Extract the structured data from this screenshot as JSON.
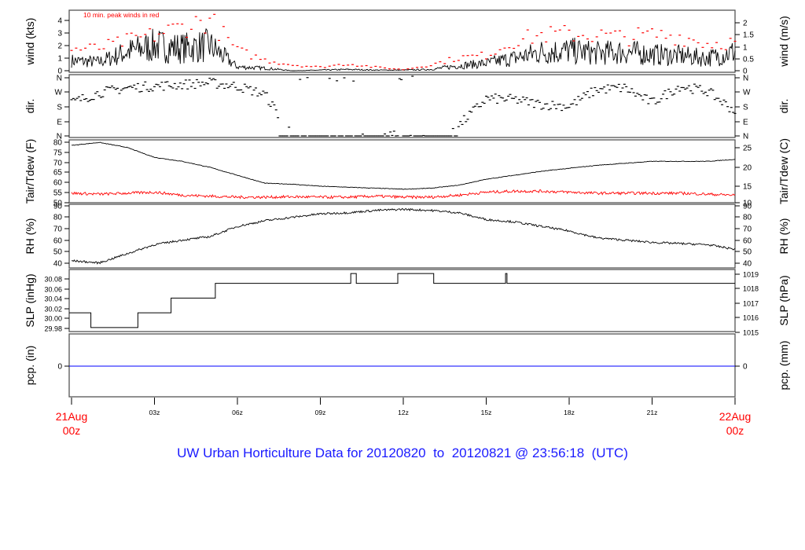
{
  "title": "UW Urban Horticulture Data for 20120820  to  20120821 @ 23:56:18  (UTC)",
  "chart_data": {
    "type": "line",
    "x_unit": "hours since 21Aug 00z",
    "x_ticks": [
      {
        "h": 0,
        "label": "21Aug",
        "sub": "00z"
      },
      {
        "h": 3,
        "label": "03z"
      },
      {
        "h": 6,
        "label": "06z"
      },
      {
        "h": 9,
        "label": "09z"
      },
      {
        "h": 12,
        "label": "12z"
      },
      {
        "h": 15,
        "label": "15z"
      },
      {
        "h": 18,
        "label": "18z"
      },
      {
        "h": 21,
        "label": "21z"
      },
      {
        "h": 24,
        "label": "22Aug",
        "sub": "00z"
      }
    ],
    "hours": [
      0,
      1,
      2,
      3,
      4,
      5,
      6,
      7,
      8,
      9,
      10,
      11,
      12,
      13,
      14,
      15,
      16,
      17,
      18,
      19,
      20,
      21,
      22,
      23,
      24
    ],
    "panels": [
      {
        "id": "wind",
        "ylabel": "wind (kts)",
        "ylabel_right": "wind (m/s)",
        "ylim": [
          0,
          4.7
        ],
        "yticks": [
          "0",
          "1",
          "2",
          "3",
          "4"
        ],
        "yticks_right": [
          "0",
          "0.5",
          "1",
          "1.5",
          "2"
        ],
        "annotation": "10 min. peak winds in red",
        "series": [
          {
            "name": "wind",
            "color": "#000000",
            "values": [
              0.8,
              0.7,
              1.5,
              2.0,
              1.8,
              2.0,
              0.3,
              0.2,
              0,
              0.05,
              0.1,
              0.05,
              0.05,
              0.1,
              0.4,
              0.6,
              1.0,
              1.5,
              1.6,
              1.4,
              1.5,
              1.3,
              1.2,
              1.0,
              1.5
            ]
          },
          {
            "name": "peak",
            "color": "#ff0000",
            "values": [
              1.8,
              1.9,
              2.5,
              3.0,
              3.7,
              4.3,
              1.7,
              0.9,
              0.5,
              0.3,
              0.6,
              0.3,
              0.1,
              0.5,
              1.1,
              1.3,
              2.5,
              3.0,
              3.1,
              3.0,
              2.8,
              3.0,
              2.9,
              2.3,
              2.4
            ]
          }
        ]
      },
      {
        "id": "dir",
        "ylabel": "dir.",
        "ylabel_right": "dir.",
        "ylim": [
          0,
          360
        ],
        "yticks": [
          "N",
          "E",
          "S",
          "W",
          "N"
        ],
        "yticks_right": [
          "N",
          "E",
          "S",
          "W",
          "N"
        ],
        "series": [
          {
            "name": "direction (deg)",
            "color": "#000000",
            "values": [
              200,
              260,
              290,
              300,
              310,
              320,
              300,
              250,
              0,
              0,
              0,
              0,
              0,
              0,
              60,
              225,
              220,
              190,
              180,
              280,
              290,
              200,
              300,
              270,
              150
            ]
          }
        ]
      },
      {
        "id": "temp",
        "ylabel": "Tair/Tdew (F)",
        "ylabel_right": "Tair/Tdew (C)",
        "ylim": [
          50,
          80
        ],
        "yticks": [
          "50",
          "55",
          "60",
          "65",
          "70",
          "75",
          "80"
        ],
        "yticks_right": [
          "10",
          "15",
          "20",
          "25"
        ],
        "series": [
          {
            "name": "Tair",
            "color": "#000000",
            "values": [
              78,
              79.5,
              77,
              72,
              70,
              67,
              63,
              59,
              58.5,
              57.5,
              57,
              56.5,
              56,
              56.5,
              58,
              61,
              63,
              65,
              66.5,
              68,
              69,
              70,
              70,
              70,
              71
            ]
          },
          {
            "name": "Tdew",
            "color": "#ff0000",
            "values": [
              54,
              53.5,
              54,
              54.5,
              53,
              52.5,
              52,
              52,
              52.2,
              52,
              52,
              52.5,
              52,
              52,
              53,
              54.5,
              55,
              55,
              54.5,
              54,
              54,
              54,
              54,
              53.5,
              53
            ]
          }
        ]
      },
      {
        "id": "rh",
        "ylabel": "RH (%)",
        "ylabel_right": "RH (%)",
        "ylim": [
          37,
          90
        ],
        "yticks": [
          "40",
          "50",
          "60",
          "70",
          "80",
          "90"
        ],
        "yticks_right": [
          "40",
          "50",
          "60",
          "70",
          "80",
          "90"
        ],
        "series": [
          {
            "name": "RH",
            "color": "#000000",
            "values": [
              42,
              40,
              48,
              56,
              60,
              63,
              72,
              77,
              80,
              83,
              84,
              86,
              87,
              86,
              84,
              78,
              76,
              72,
              68,
              62,
              60,
              58,
              57,
              56,
              52
            ]
          }
        ]
      },
      {
        "id": "slp",
        "ylabel": "SLP (inHg)",
        "ylabel_right": "SLP (hPa)",
        "ylim": [
          29.97,
          30.09
        ],
        "yticks": [
          "29.98",
          "30.00",
          "30.02",
          "30.04",
          "30.06",
          "30.08"
        ],
        "yticks_right": [
          "1015",
          "1016",
          "1017",
          "1018",
          "1019"
        ],
        "steps": [
          [
            0,
            30.005
          ],
          [
            0.7,
            29.975
          ],
          [
            2.4,
            30.005
          ],
          [
            3.6,
            30.035
          ],
          [
            5.2,
            30.065
          ],
          [
            10.1,
            30.085
          ],
          [
            10.3,
            30.065
          ],
          [
            11.8,
            30.085
          ],
          [
            13.1,
            30.065
          ],
          [
            15.7,
            30.085
          ],
          [
            15.75,
            30.065
          ],
          [
            24,
            30.065
          ]
        ]
      },
      {
        "id": "pcp",
        "ylabel": "pcp. (in)",
        "ylabel_right": "pcp. (mm)",
        "ylim": [
          -1,
          1
        ],
        "yticks": [
          "0"
        ],
        "yticks_right": [
          "0"
        ],
        "series": [
          {
            "name": "precip",
            "color": "#0000ff",
            "values": [
              0,
              0
            ]
          }
        ]
      }
    ]
  }
}
